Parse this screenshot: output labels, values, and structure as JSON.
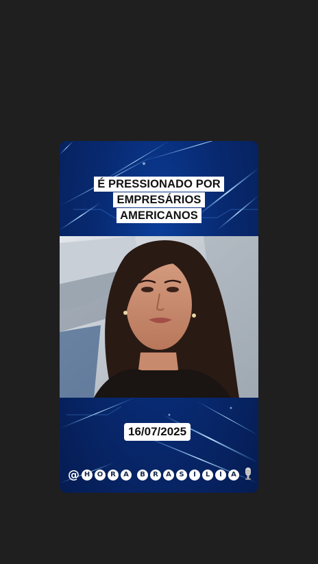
{
  "background_color": "#1f1f1f",
  "card": {
    "accent_color": "#0b3f9c",
    "headline_lines": [
      "É PRESSIONADO POR",
      "EMPRESÁRIOS",
      "AMERICANOS"
    ],
    "date": "16/07/2025",
    "handle": {
      "at_sign": "@",
      "word1": [
        "H",
        "O",
        "R",
        "A"
      ],
      "word2": [
        "B",
        "R",
        "A",
        "S",
        "I",
        "L",
        "I",
        "A"
      ],
      "icon": "microphone-icon"
    }
  }
}
